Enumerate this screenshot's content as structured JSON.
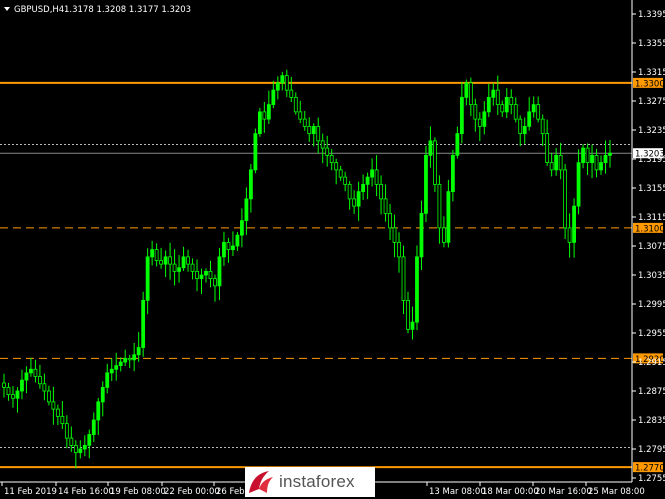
{
  "header": {
    "symbol": "GBPUSD,H4",
    "ohlc": "1.3178 1.3208 1.3177 1.3203"
  },
  "colors": {
    "background": "#000000",
    "candle": "#00ff00",
    "level_line": "#ff9900",
    "label_bg": "#ff9900",
    "price_label_bg": "#ffffff",
    "axis_text": "#ffffff",
    "grid_dotted": "#ffffff"
  },
  "price_axis": {
    "ticks": [
      "1.3395",
      "1.3355",
      "1.3315",
      "1.3275",
      "1.3235",
      "1.3195",
      "1.3155",
      "1.3115",
      "1.3075",
      "1.3035",
      "1.2995",
      "1.2955",
      "1.2915",
      "1.2875",
      "1.2835",
      "1.2795",
      "1.2755"
    ]
  },
  "time_axis": {
    "ticks": [
      "11 Feb 2019",
      "14 Feb 16:00",
      "19 Feb 08:00",
      "22 Feb 00:00",
      "26 Feb",
      "13 Mar 08:00",
      "18 Mar 00:00",
      "20 Mar 16:00",
      "25 Mar 08:00"
    ]
  },
  "levels": [
    {
      "label": "1.3300",
      "value": 1.33,
      "style": "solid"
    },
    {
      "label": "1.3100",
      "value": 1.31,
      "style": "dashed"
    },
    {
      "label": "1.2920",
      "value": 1.292,
      "style": "dashed"
    },
    {
      "label": "1.2770",
      "value": 1.277,
      "style": "solid"
    }
  ],
  "current_price": {
    "label": "1.3203",
    "value": 1.3203
  },
  "chart_data": {
    "type": "candlestick",
    "xlabel": "",
    "ylabel": "",
    "ylim": [
      1.2755,
      1.341
    ],
    "title": "GBPUSD,H4",
    "closes": [
      1.288,
      1.287,
      1.2865,
      1.2875,
      1.289,
      1.29,
      1.2905,
      1.2895,
      1.2885,
      1.2875,
      1.286,
      1.285,
      1.284,
      1.283,
      1.281,
      1.28,
      1.279,
      1.2795,
      1.28,
      1.2815,
      1.2835,
      1.286,
      1.288,
      1.29,
      1.2905,
      1.291,
      1.2915,
      1.292,
      1.2918,
      1.2925,
      1.2935,
      1.3,
      1.306,
      1.307,
      1.3055,
      1.305,
      1.306,
      1.305,
      1.304,
      1.3045,
      1.306,
      1.305,
      1.304,
      1.303,
      1.3035,
      1.304,
      1.303,
      1.302,
      1.306,
      1.308,
      1.307,
      1.3075,
      1.309,
      1.311,
      1.314,
      1.318,
      1.323,
      1.326,
      1.325,
      1.327,
      1.329,
      1.33,
      1.331,
      1.329,
      1.328,
      1.326,
      1.325,
      1.324,
      1.323,
      1.324,
      1.322,
      1.321,
      1.32,
      1.319,
      1.318,
      1.317,
      1.316,
      1.314,
      1.313,
      1.315,
      1.316,
      1.317,
      1.318,
      1.316,
      1.314,
      1.312,
      1.31,
      1.308,
      1.306,
      1.3,
      1.296,
      1.297,
      1.306,
      1.312,
      1.32,
      1.322,
      1.316,
      1.31,
      1.308,
      1.315,
      1.32,
      1.323,
      1.328,
      1.33,
      1.327,
      1.325,
      1.324,
      1.326,
      1.328,
      1.329,
      1.327,
      1.326,
      1.328,
      1.327,
      1.325,
      1.323,
      1.324,
      1.326,
      1.327,
      1.325,
      1.323,
      1.319,
      1.318,
      1.32,
      1.318,
      1.31,
      1.308,
      1.313,
      1.319,
      1.321,
      1.319,
      1.32,
      1.318,
      1.319,
      1.32,
      1.3203
    ]
  },
  "logo": {
    "name": "instaforex"
  }
}
